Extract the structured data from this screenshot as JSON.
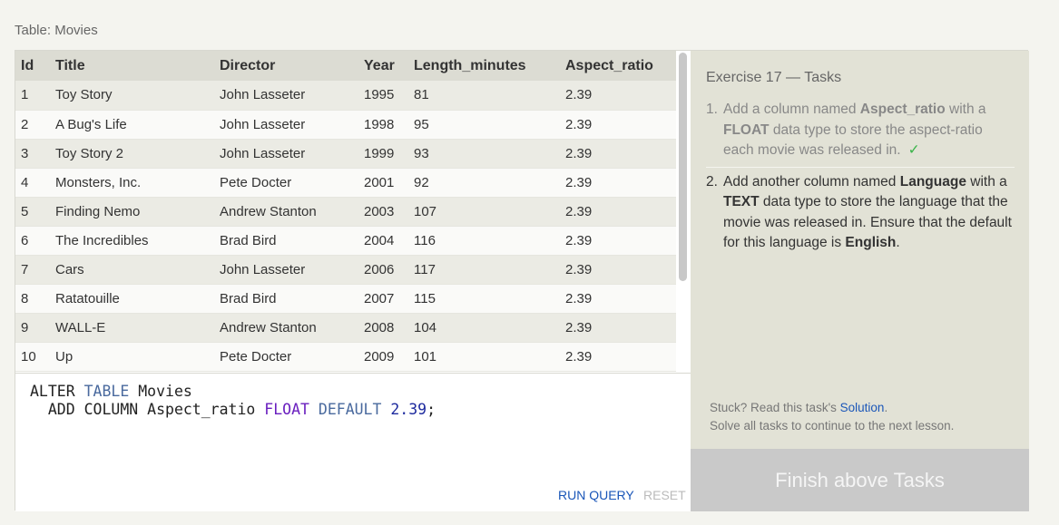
{
  "table_caption": "Table: Movies",
  "table": {
    "columns": [
      "Id",
      "Title",
      "Director",
      "Year",
      "Length_minutes",
      "Aspect_ratio"
    ],
    "rows": [
      [
        "1",
        "Toy Story",
        "John Lasseter",
        "1995",
        "81",
        "2.39"
      ],
      [
        "2",
        "A Bug's Life",
        "John Lasseter",
        "1998",
        "95",
        "2.39"
      ],
      [
        "3",
        "Toy Story 2",
        "John Lasseter",
        "1999",
        "93",
        "2.39"
      ],
      [
        "4",
        "Monsters, Inc.",
        "Pete Docter",
        "2001",
        "92",
        "2.39"
      ],
      [
        "5",
        "Finding Nemo",
        "Andrew Stanton",
        "2003",
        "107",
        "2.39"
      ],
      [
        "6",
        "The Incredibles",
        "Brad Bird",
        "2004",
        "116",
        "2.39"
      ],
      [
        "7",
        "Cars",
        "John Lasseter",
        "2006",
        "117",
        "2.39"
      ],
      [
        "8",
        "Ratatouille",
        "Brad Bird",
        "2007",
        "115",
        "2.39"
      ],
      [
        "9",
        "WALL-E",
        "Andrew Stanton",
        "2008",
        "104",
        "2.39"
      ],
      [
        "10",
        "Up",
        "Pete Docter",
        "2009",
        "101",
        "2.39"
      ]
    ]
  },
  "editor": {
    "line1": {
      "a": "ALTER ",
      "b": "TABLE",
      "c": " Movies"
    },
    "line2": {
      "a": "  ADD COLUMN Aspect_ratio ",
      "b": "FLOAT",
      "c": " ",
      "d": "DEFAULT",
      "e": " ",
      "f": "2.39",
      "g": ";"
    },
    "run_label": "RUN QUERY",
    "reset_label": "RESET"
  },
  "tasks": {
    "title": "Exercise 17 — Tasks",
    "items": [
      {
        "num": "1.",
        "parts": [
          "Add a column named ",
          "Aspect_ratio",
          " with a ",
          "FLOAT",
          " data type to store the aspect-ratio each movie was released in."
        ],
        "check": "✓"
      },
      {
        "num": "2.",
        "parts": [
          "Add another column named ",
          "Language",
          " with a ",
          "TEXT",
          " data type to store the language that the movie was released in. Ensure that the default for this language is ",
          "English",
          "."
        ]
      }
    ],
    "stuck_prefix": "Stuck? Read this task's ",
    "solution_link": "Solution",
    "stuck_suffix": ".",
    "continue_note": "Solve all tasks to continue to the next lesson.",
    "finish_label": "Finish above Tasks"
  },
  "colors": {
    "accent_link": "#1a56b8",
    "check_green": "#3cb44b",
    "keyword": "#4a6a9e",
    "type": "#6a1fbf",
    "number": "#1d2a9e"
  }
}
